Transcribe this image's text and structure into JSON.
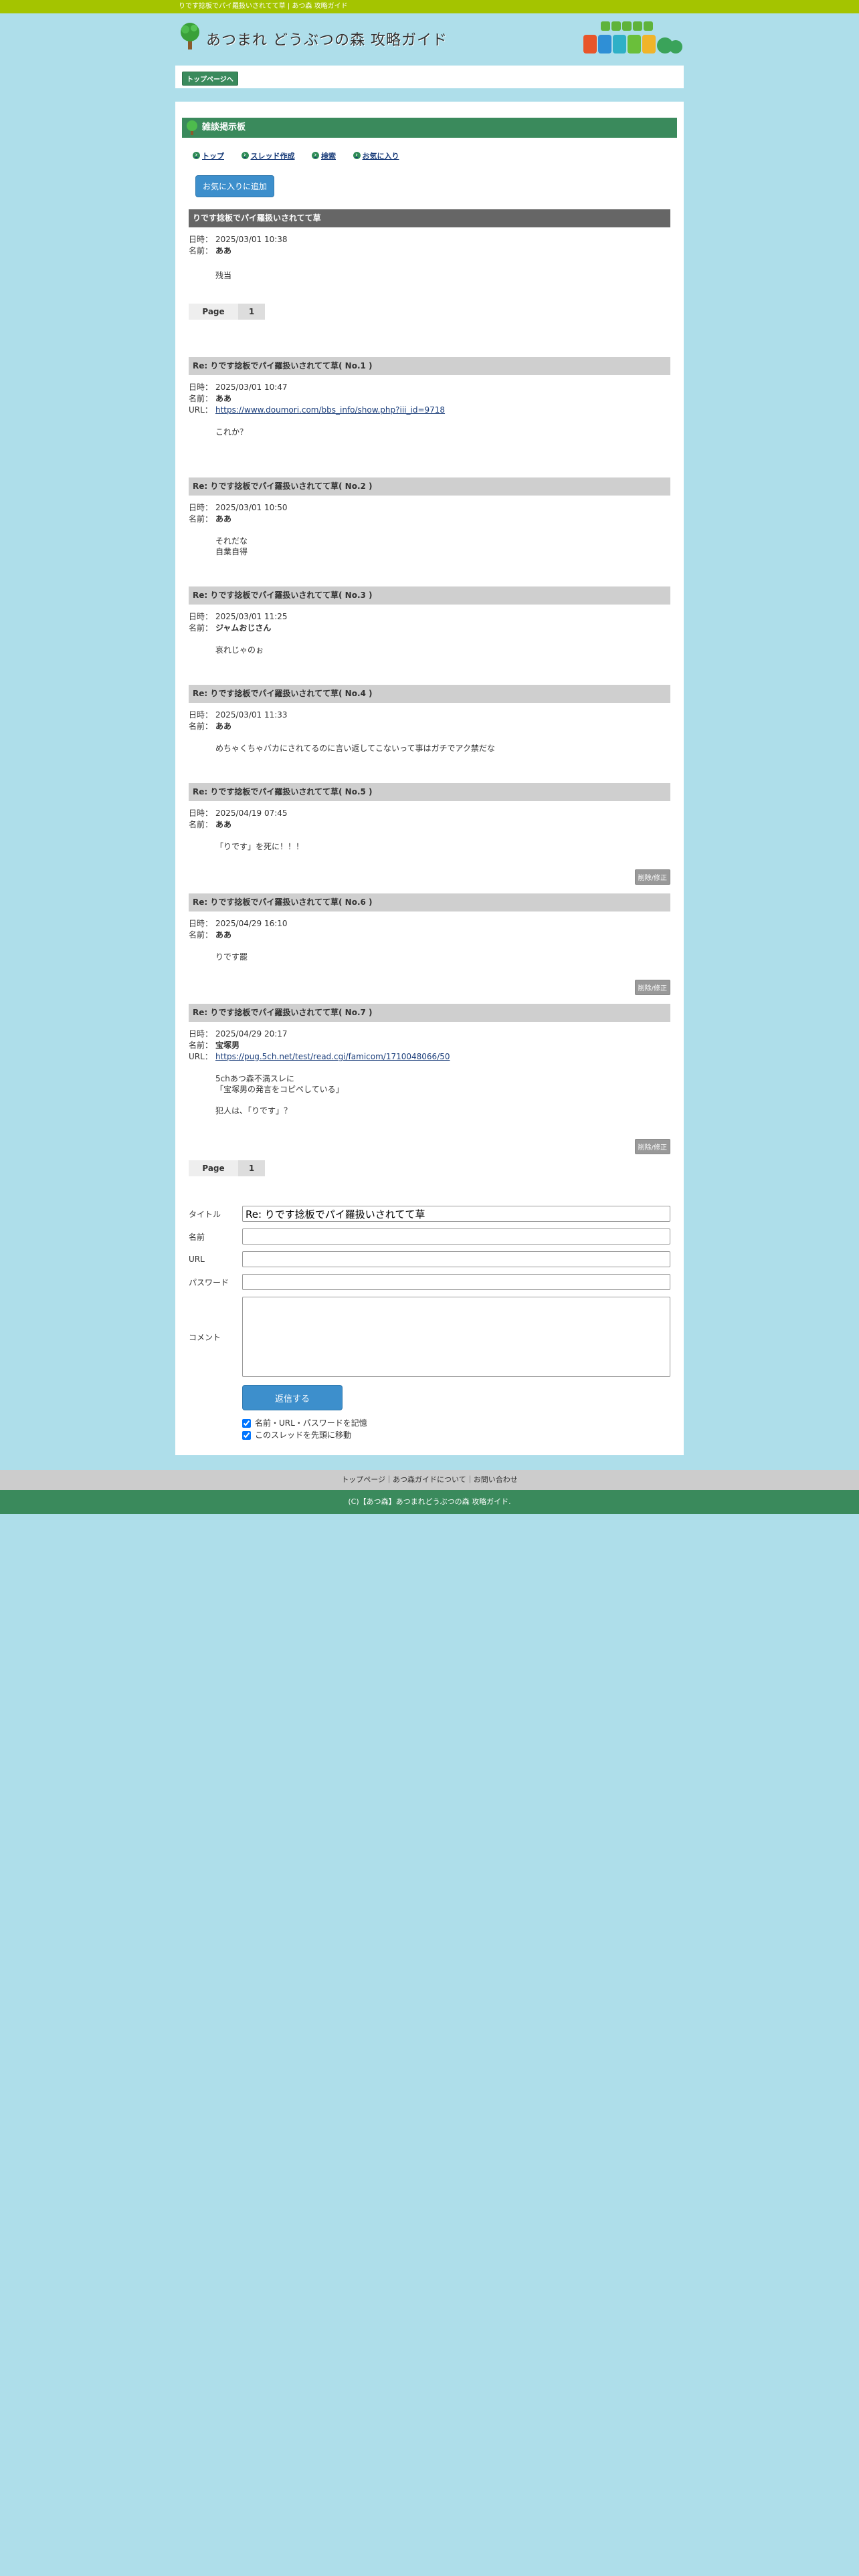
{
  "topbar": {
    "text": "りです捻板でパイ羅扱いされてて草 | あつ森 攻略ガイド"
  },
  "header": {
    "site_title": "あつまれ どうぶつの森 攻略ガイド",
    "brand_text": "あつまれ どうぶつの森"
  },
  "breadcrumb": {
    "top_label": "トップページへ"
  },
  "board": {
    "title": "雑談掲示板",
    "nav": [
      "トップ",
      "スレッド作成",
      "検索",
      "お気に入り"
    ],
    "fav_button": "お気に入りに追加"
  },
  "labels": {
    "date": "日時：",
    "name": "名前：",
    "url": "URL：",
    "page": "Page",
    "page_num": "1",
    "edit": "削除/修正"
  },
  "posts": [
    {
      "title": "りです捻板でパイ羅扱いされてて草",
      "date": "2025/03/01 10:38",
      "name": "ああ",
      "url": "",
      "body": [
        "残当"
      ]
    },
    {
      "title": "Re: りです捻板でパイ羅扱いされてて草( No.1 )",
      "date": "2025/03/01 10:47",
      "name": "ああ",
      "url": "https://www.doumori.com/bbs_info/show.php?iii_id=9718",
      "body": [
        "これか？"
      ]
    },
    {
      "title": "Re: りです捻板でパイ羅扱いされてて草( No.2 )",
      "date": "2025/03/01 10:50",
      "name": "ああ",
      "url": "",
      "body": [
        "それだな",
        "自業自得"
      ]
    },
    {
      "title": "Re: りです捻板でパイ羅扱いされてて草( No.3 )",
      "date": "2025/03/01 11:25",
      "name": "ジャムおじさん",
      "url": "",
      "body": [
        "哀れじゃのぉ"
      ]
    },
    {
      "title": "Re: りです捻板でパイ羅扱いされてて草( No.4 )",
      "date": "2025/03/01 11:33",
      "name": "ああ",
      "url": "",
      "body": [
        "めちゃくちゃバカにされてるのに言い返してこないって事はガチでアク禁だな"
      ]
    },
    {
      "title": "Re: りです捻板でパイ羅扱いされてて草( No.5 )",
      "date": "2025/04/19 07:45",
      "name": "ああ",
      "url": "",
      "body": [
        "「りです」を死に！！！"
      ]
    },
    {
      "title": "Re: りです捻板でパイ羅扱いされてて草( No.6 )",
      "date": "2025/04/29 16:10",
      "name": "ああ",
      "url": "",
      "body": [
        "りです罷"
      ]
    },
    {
      "title": "Re: りです捻板でパイ羅扱いされてて草( No.7 )",
      "date": "2025/04/29 20:17",
      "name": "宝塚男",
      "url": "https://pug.5ch.net/test/read.cgi/famicom/1710048066/50",
      "body": [
        "5chあつ森不満スレに",
        "「宝塚男の発言をコピペしている」",
        "",
        "犯人は、「りです」？"
      ]
    }
  ],
  "form": {
    "title_label": "タイトル",
    "title_value": "Re: りです捻板でパイ羅扱いされてて草",
    "name_label": "名前",
    "url_label": "URL",
    "password_label": "パスワード",
    "comment_label": "コメント",
    "submit_label": "返信する",
    "remember_label": "名前・URL・パスワードを記憶",
    "move_label": "このスレッドを先頭に移動"
  },
  "footer": {
    "nav_text": "トップページ｜あつ森ガイドについて｜お問い合わせ",
    "copyright": "(C)【あつ森】あつまれどうぶつの森 攻略ガイド."
  }
}
